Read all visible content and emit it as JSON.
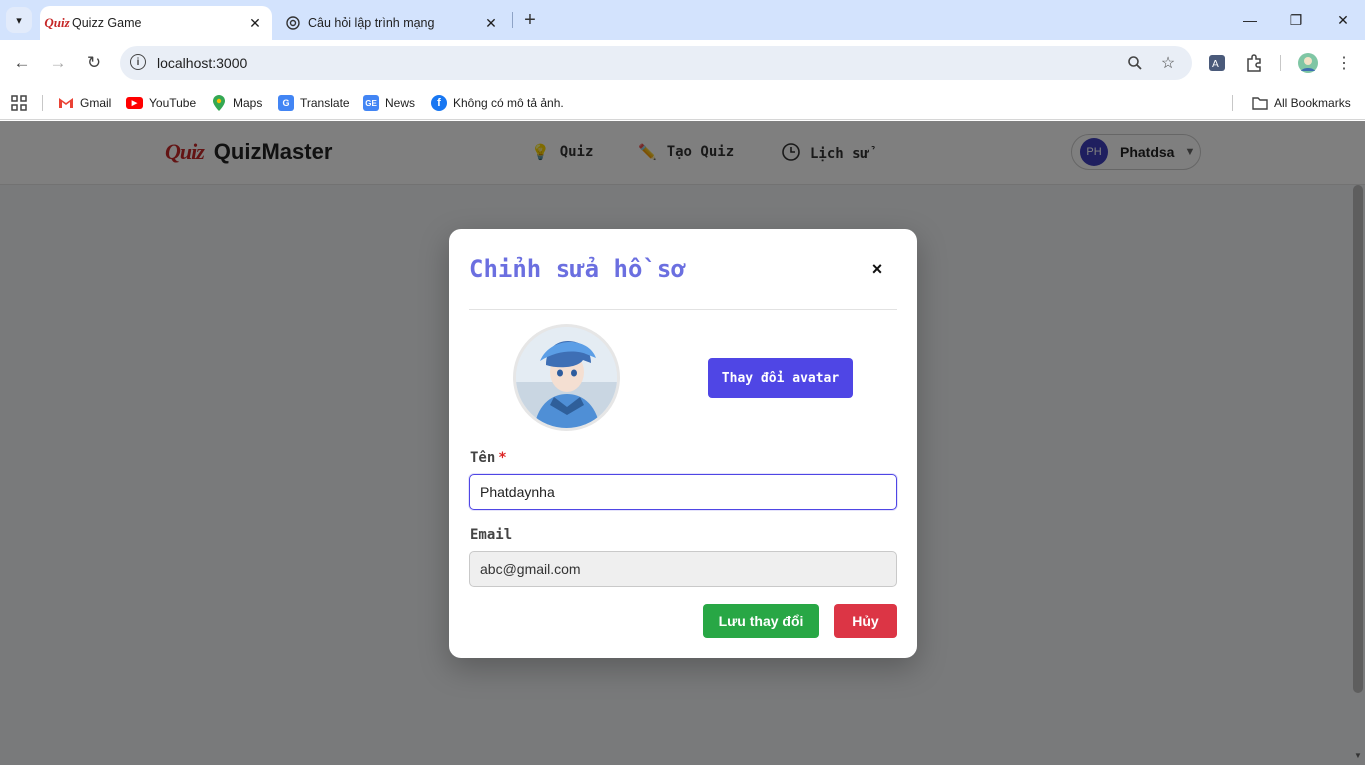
{
  "browser": {
    "tabs": [
      {
        "title": "Quizz Game",
        "favicon": "Quiz",
        "active": true
      },
      {
        "title": "Câu hỏi lập trình mạng",
        "favicon": "openai-icon",
        "active": false
      }
    ],
    "url": "localhost:3000",
    "bookmarks": [
      {
        "label": "Gmail",
        "icon": "gmail-icon"
      },
      {
        "label": "YouTube",
        "icon": "youtube-icon"
      },
      {
        "label": "Maps",
        "icon": "maps-icon"
      },
      {
        "label": "Translate",
        "icon": "translate-icon"
      },
      {
        "label": "News",
        "icon": "news-icon"
      },
      {
        "label": "Không có mô tả ảnh.",
        "icon": "facebook-icon"
      }
    ],
    "all_bookmarks": "All Bookmarks"
  },
  "app": {
    "brand_logo": "Quiz",
    "brand_name": "QuizMaster",
    "nav": [
      {
        "label": "Quiz",
        "icon": "lightbulb-icon"
      },
      {
        "label": "Tạo Quiz",
        "icon": "pencil-icon"
      },
      {
        "label": "Lịch sử",
        "icon": "clock-icon"
      }
    ],
    "user": {
      "initials": "PH",
      "name": "Phatdsa"
    }
  },
  "modal": {
    "title": "Chỉnh sửa hồ sơ",
    "close": "×",
    "change_avatar": "Thay đổi avatar",
    "name_label": "Tên",
    "required_mark": "*",
    "name_value": "Phatdaynha",
    "email_label": "Email",
    "email_value": "abc@gmail.com",
    "save": "Lưu thay đổi",
    "cancel": "Hủy"
  },
  "colors": {
    "accent": "#4f46e5",
    "title": "#6b6fe0",
    "save": "#28a745",
    "cancel": "#dc3545"
  }
}
